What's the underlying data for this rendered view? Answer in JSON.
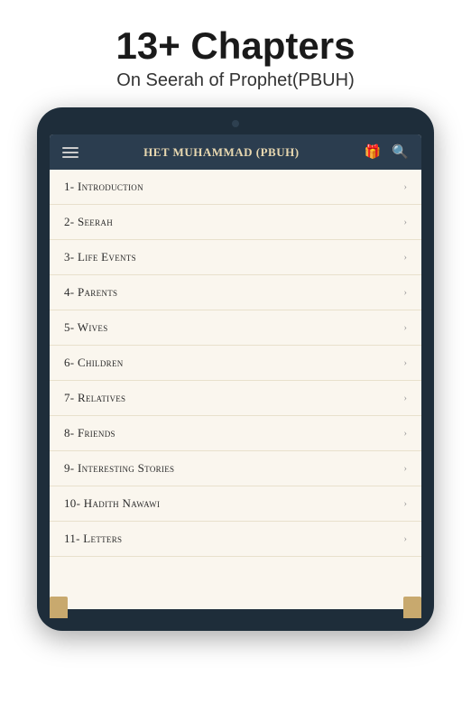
{
  "header": {
    "main_title": "13+ Chapters",
    "subtitle": "On Seerah of Prophet(PBUH)"
  },
  "app": {
    "header_title": "het Muhammad (PBUH)",
    "gift_icon": "🎁",
    "search_icon": "🔍"
  },
  "chapters": [
    {
      "number": "1-",
      "title": "Introduction"
    },
    {
      "number": "2-",
      "title": "Seerah"
    },
    {
      "number": "3-",
      "title": "Life Events"
    },
    {
      "number": "4-",
      "title": "Parents"
    },
    {
      "number": "5-",
      "title": "Wives"
    },
    {
      "number": "6-",
      "title": "Children"
    },
    {
      "number": "7-",
      "title": "Relatives"
    },
    {
      "number": "8-",
      "title": "Friends"
    },
    {
      "number": "9-",
      "title": "Interesting Stories"
    },
    {
      "number": "10-",
      "title": "Hadith Nawawi"
    },
    {
      "number": "11-",
      "title": "Letters"
    }
  ]
}
